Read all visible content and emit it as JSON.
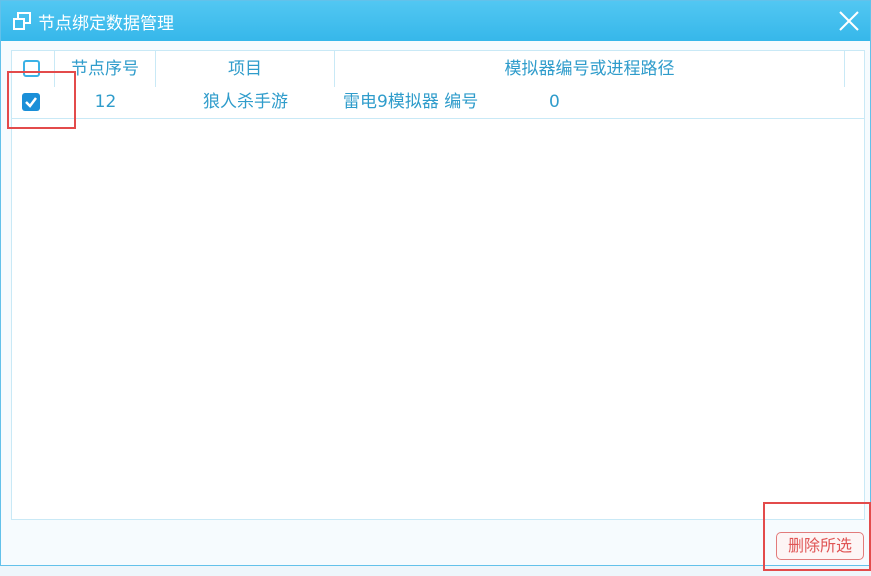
{
  "window": {
    "title": "节点绑定数据管理",
    "title_icon": "restore-window-icon",
    "close_icon": "close-icon"
  },
  "table": {
    "columns": [
      "节点序号",
      "项目",
      "模拟器编号或进程路径"
    ],
    "rows": [
      {
        "checked": true,
        "node": "12",
        "project": "狼人杀手游",
        "emulator": "雷电9模拟器 编号",
        "emulator_no": "0"
      }
    ]
  },
  "actions": {
    "delete_selected": "删除所选"
  },
  "colors": {
    "title_bar": "#3ebcec",
    "accent": "#2f9ccb",
    "highlight_box": "#e34b4b",
    "delete_text": "#e05555"
  }
}
